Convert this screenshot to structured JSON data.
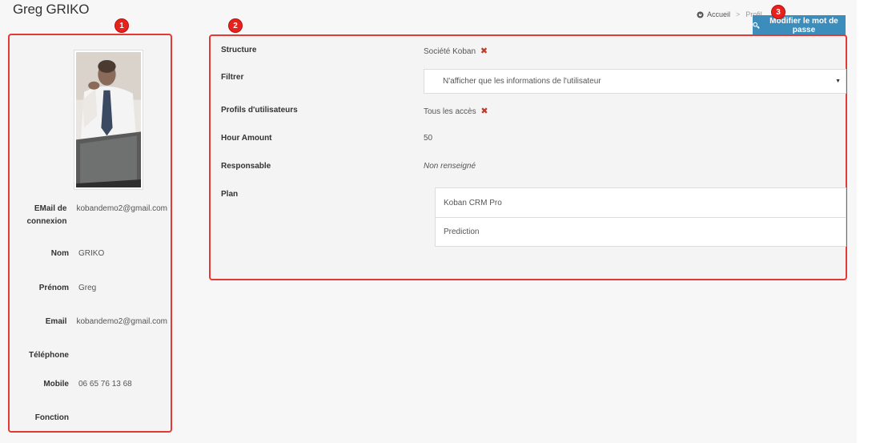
{
  "header": {
    "title": "Greg GRIKO",
    "breadcrumb": [
      "Accueil",
      "Profil"
    ],
    "breadcrumb_separator": ">",
    "password_button": "Modifier le mot de passe"
  },
  "badges": [
    "1",
    "2",
    "3"
  ],
  "profile": {
    "fields": [
      {
        "label": "EMail de connexion",
        "value": "kobandemo2@gmail.com"
      },
      {
        "label": "Nom",
        "value": "GRIKO"
      },
      {
        "label": "Prénom",
        "value": "Greg"
      },
      {
        "label": "Email",
        "value": "kobandemo2@gmail.com"
      },
      {
        "label": "Téléphone",
        "value": ""
      },
      {
        "label": "Mobile",
        "value": "06 65 76 13 68"
      },
      {
        "label": "Fonction",
        "value": ""
      }
    ]
  },
  "details": {
    "structure": {
      "label": "Structure",
      "value": "Société Koban"
    },
    "filtrer": {
      "label": "Filtrer",
      "selected": "N'afficher que les informations de l'utilisateur"
    },
    "profils": {
      "label": "Profils d'utilisateurs",
      "value": "Tous les accès"
    },
    "hour_amount": {
      "label": "Hour Amount",
      "value": "50"
    },
    "responsable": {
      "label": "Responsable",
      "value": "Non renseigné"
    },
    "plan": {
      "label": "Plan",
      "items": [
        "Koban CRM Pro",
        "Prediction"
      ]
    },
    "remove_symbol": "✖"
  },
  "colors": {
    "accent": "#3c8dbc",
    "annotation": "#e53935"
  }
}
